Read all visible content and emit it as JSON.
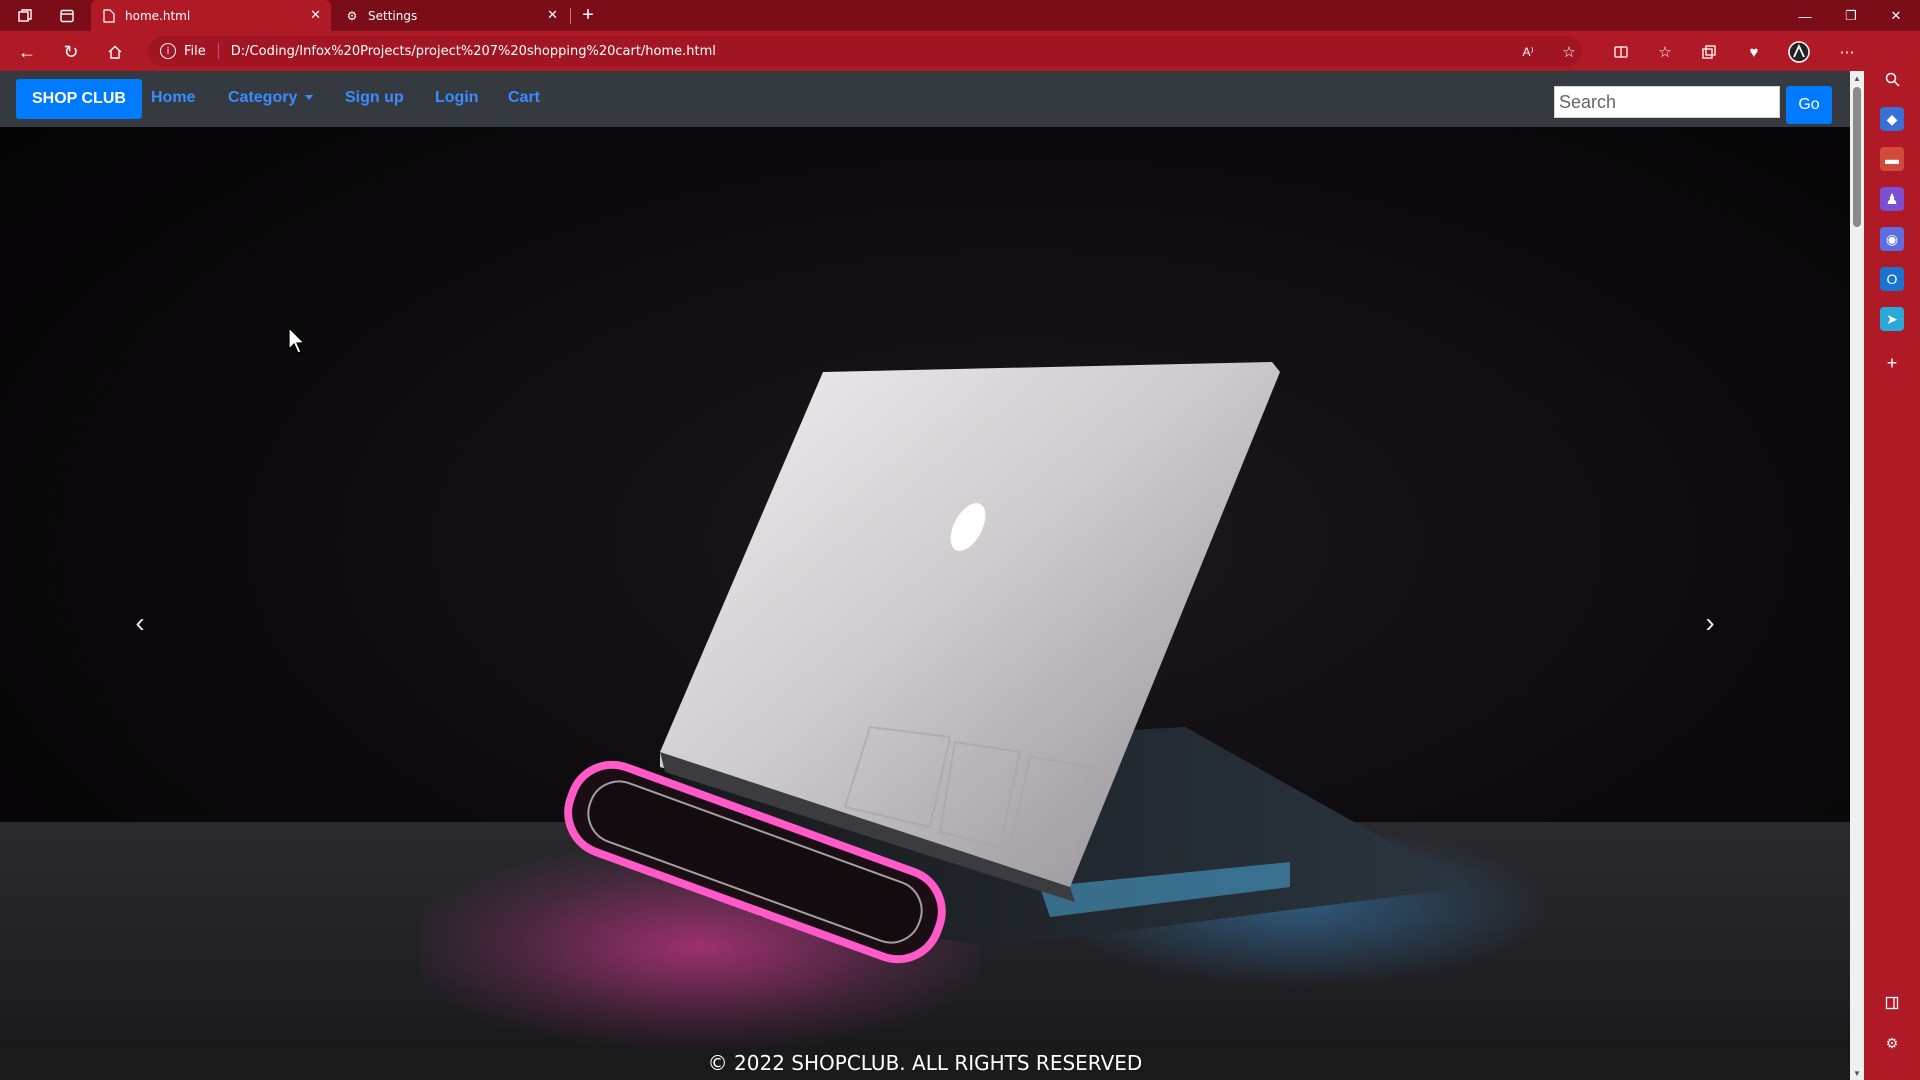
{
  "browser": {
    "tabs": [
      {
        "title": "home.html",
        "active": true,
        "icon": "file-icon"
      },
      {
        "title": "Settings",
        "active": false,
        "icon": "gear-icon"
      }
    ],
    "address": {
      "scheme_label": "File",
      "url": "D:/Coding/Infox%20Projects/project%207%20shopping%20cart/home.html"
    },
    "accent": "#b01a26",
    "tabbar_color": "#7a0d18"
  },
  "site": {
    "brand": "SHOP CLUB",
    "nav": {
      "home": "Home",
      "category": "Category",
      "signup": "Sign up",
      "login": "Login",
      "cart": "Cart"
    },
    "search": {
      "placeholder": "Search",
      "button": "Go"
    },
    "carousel": {
      "prev": "previous-slide",
      "next": "next-slide",
      "image": "laptop-with-pink-glow"
    },
    "footer": "© 2022 SHOPCLUB. ALL RIGHTS RESERVED",
    "colors": {
      "primary": "#007bff",
      "navbar": "#343a40",
      "link": "#3b8bff"
    }
  }
}
